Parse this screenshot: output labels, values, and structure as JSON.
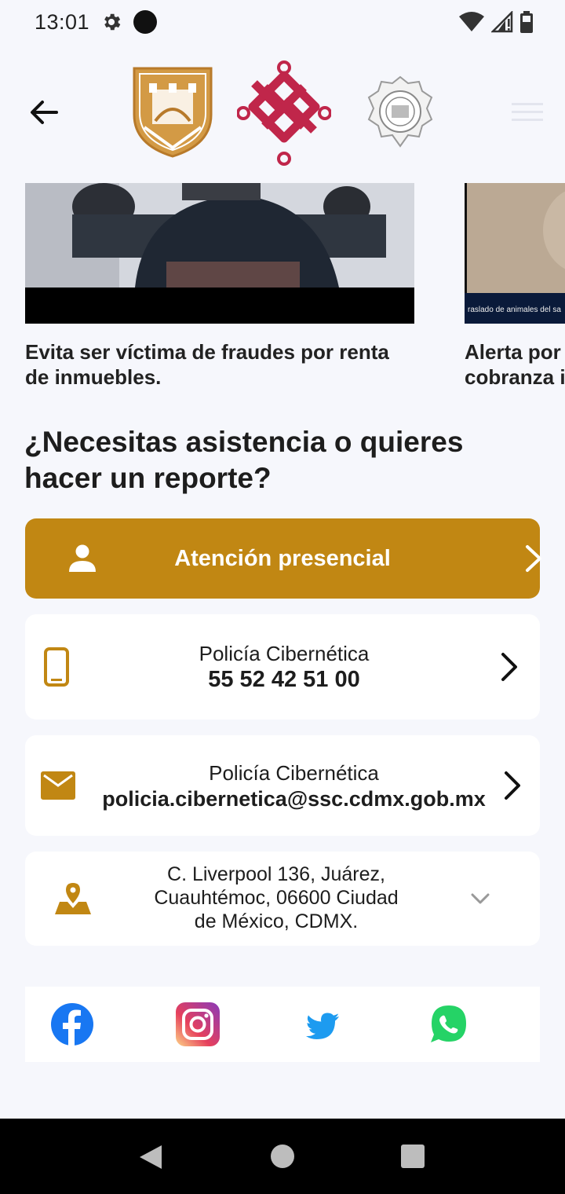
{
  "status_bar": {
    "time": "13:01",
    "icons": [
      "gear-icon",
      "dot-icon",
      "wifi-icon",
      "signal-icon",
      "battery-icon"
    ]
  },
  "header": {
    "back_icon": "arrow-left-icon",
    "logos": [
      "cdmx-shield-logo",
      "cdmx-knot-logo",
      "ssc-police-badge-logo"
    ],
    "menu_icon": "hamburger-menu-icon"
  },
  "news": [
    {
      "title": "Evita ser víctima de fraudes por renta de inmuebles."
    },
    {
      "title": "Alerta por cobranza i",
      "caption": "raslado de animales del sa"
    }
  ],
  "assistance": {
    "title": "¿Necesitas asistencia o quieres hacer un reporte?",
    "primary_button": {
      "label": "Atención presencial",
      "icon": "person-icon"
    },
    "phone": {
      "label": "Policía Cibernética",
      "value": "55 52 42 51 00",
      "icon": "smartphone-icon"
    },
    "email": {
      "label": "Policía Cibernética",
      "value": "policia.cibernetica@ssc.cdmx.gob.mx",
      "icon": "mail-icon"
    },
    "address": {
      "text": "C. Liverpool 136, Juárez, Cuauhtémoc, 06600 Ciudad de México, CDMX.",
      "icon": "map-pin-icon"
    }
  },
  "social": [
    "facebook-icon",
    "instagram-icon",
    "twitter-icon",
    "whatsapp-icon"
  ],
  "colors": {
    "accent_gold": "#c18713",
    "brand_red": "#c0264a",
    "background": "#f6f7fc",
    "facebook": "#1877f2",
    "twitter": "#1d9bf0",
    "whatsapp": "#25d366"
  }
}
